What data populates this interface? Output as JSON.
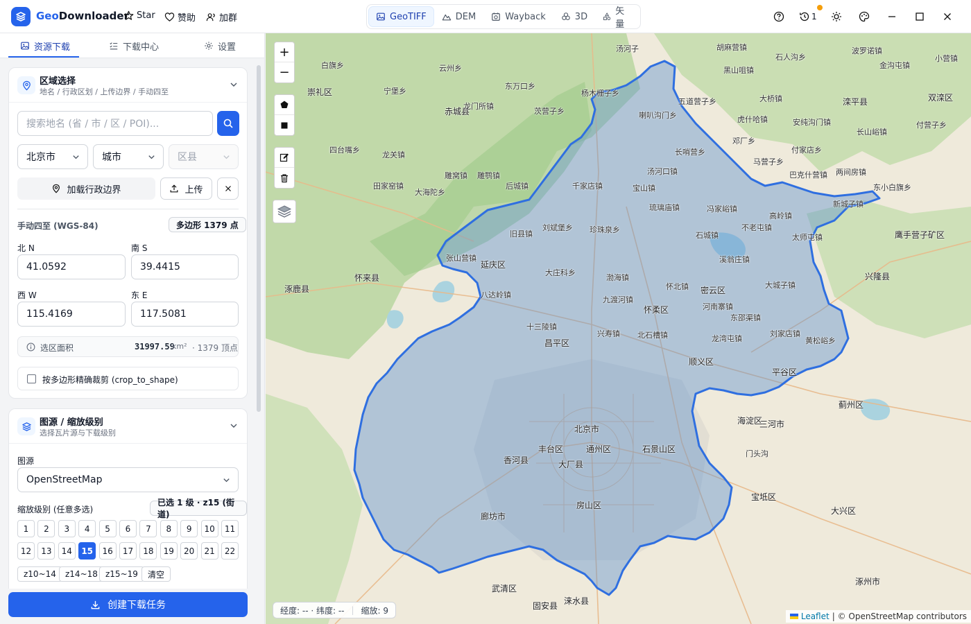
{
  "app": {
    "name_accent": "Geo",
    "name_rest": "Downloader"
  },
  "header_links": {
    "star": "Star",
    "like": "赞助",
    "group": "加群"
  },
  "modes": [
    {
      "label": "GeoTIFF",
      "icon": "image-icon"
    },
    {
      "label": "DEM",
      "icon": "mountain-icon"
    },
    {
      "label": "Wayback",
      "icon": "history-icon"
    },
    {
      "label": "3D",
      "icon": "cube-icon"
    },
    {
      "label": "矢量",
      "icon": "shapes-icon"
    }
  ],
  "history_count": "1",
  "subtabs": {
    "resources": "资源下载",
    "downloads": "下载中心",
    "settings": "设置"
  },
  "region": {
    "title": "区域选择",
    "subtitle": "地名 / 行政区划 / 上传边界 / 手动四至",
    "search_placeholder": "搜索地名 (省 / 市 / 区 / POI)...",
    "province": "北京市",
    "city": "城市",
    "county": "区县",
    "load_boundary": "加载行政边界",
    "upload": "上传",
    "manual_label": "手动四至 (WGS-84)",
    "polygon_badge": "多边形 1379 点",
    "north_label": "北 N",
    "north_value": "41.0592",
    "south_label": "南 S",
    "south_value": "39.4415",
    "west_label": "西 W",
    "west_value": "115.4169",
    "east_label": "东 E",
    "east_value": "117.5081",
    "area_label": "选区面积",
    "area_value": "31997.59",
    "area_unit": "km²",
    "vertex_text": "· 1379 顶点",
    "crop_label": "按多边形精确裁剪 (crop_to_shape)"
  },
  "source": {
    "title": "图源 / 缩放级别",
    "subtitle": "选择瓦片源与下载级别",
    "source_label": "图源",
    "source_value": "OpenStreetMap",
    "zoom_label": "缩放级别 (任意多选)",
    "zoom_badge": "已选 1 级 · z15 (街道)",
    "zoom_levels": [
      "1",
      "2",
      "3",
      "4",
      "5",
      "6",
      "7",
      "8",
      "9",
      "10",
      "11",
      "12",
      "13",
      "14",
      "15",
      "16",
      "17",
      "18",
      "19",
      "20",
      "21",
      "22"
    ],
    "selected_zoom": "15",
    "presets": [
      "z10~14",
      "z14~18",
      "z15~19",
      "清空"
    ]
  },
  "create_button": "创建下载任务",
  "map": {
    "zoom_in": "+",
    "zoom_out": "−",
    "coord_text": "经度: -- · 纬度: --",
    "zoom_text": "缩放: 9",
    "attribution_leaflet": "Leaflet",
    "attribution_rest": "| © OpenStreetMap contributors",
    "colors": {
      "boundary": "#2f6fe0",
      "fill": "#5b8fcf"
    },
    "places": [
      {
        "name": "汤河子",
        "big": false
      },
      {
        "name": "胡麻营镇",
        "big": false
      },
      {
        "name": "石人沟乡",
        "big": false
      },
      {
        "name": "波罗诺镇",
        "big": false
      },
      {
        "name": "小营镇",
        "big": false
      },
      {
        "name": "白旗乡",
        "big": false
      },
      {
        "name": "云州乡",
        "big": false
      },
      {
        "name": "黑山咀镇",
        "big": false
      },
      {
        "name": "金沟屯镇",
        "big": false
      },
      {
        "name": "崇礼区",
        "big": true
      },
      {
        "name": "东万口乡",
        "big": false
      },
      {
        "name": "赤城县",
        "big": true
      },
      {
        "name": "杨木栅子乡",
        "big": false
      },
      {
        "name": "五道营子乡",
        "big": false
      },
      {
        "name": "大桥镇",
        "big": false
      },
      {
        "name": "滦平县",
        "big": true
      },
      {
        "name": "双滦区",
        "big": true
      },
      {
        "name": "宁堡乡",
        "big": false
      },
      {
        "name": "龙门所镇",
        "big": false
      },
      {
        "name": "茨营子乡",
        "big": false
      },
      {
        "name": "喇叭沟门乡",
        "big": false
      },
      {
        "name": "虎什哈镇",
        "big": false
      },
      {
        "name": "安纯沟门镇",
        "big": false
      },
      {
        "name": "长山峪镇",
        "big": false
      },
      {
        "name": "付营子乡",
        "big": false
      },
      {
        "name": "雕鹗镇",
        "big": false
      },
      {
        "name": "四台嘴乡",
        "big": false
      },
      {
        "name": "龙关镇",
        "big": false
      },
      {
        "name": "长哨营乡",
        "big": false
      },
      {
        "name": "邓厂乡",
        "big": false
      },
      {
        "name": "付家店乡",
        "big": false
      },
      {
        "name": "汤河口镇",
        "big": false
      },
      {
        "name": "马营子乡",
        "big": false
      },
      {
        "name": "巴克什营镇",
        "big": false
      },
      {
        "name": "两间房镇",
        "big": false
      },
      {
        "name": "雕窝镇",
        "big": false
      },
      {
        "name": "田家窑镇",
        "big": false
      },
      {
        "name": "大海陀乡",
        "big": false
      },
      {
        "name": "后城镇",
        "big": false
      },
      {
        "name": "千家店镇",
        "big": false
      },
      {
        "name": "宝山镇",
        "big": false
      },
      {
        "name": "琉璃庙镇",
        "big": false
      },
      {
        "name": "冯家峪镇",
        "big": false
      },
      {
        "name": "新城子镇",
        "big": false
      },
      {
        "name": "东小白旗乡",
        "big": false
      },
      {
        "name": "鹰手营子矿区",
        "big": true
      },
      {
        "name": "刘斌堡乡",
        "big": false
      },
      {
        "name": "珍珠泉乡",
        "big": false
      },
      {
        "name": "石城镇",
        "big": false
      },
      {
        "name": "不老屯镇",
        "big": false
      },
      {
        "name": "高岭镇",
        "big": false
      },
      {
        "name": "太师屯镇",
        "big": false
      },
      {
        "name": "旧县镇",
        "big": false
      },
      {
        "name": "张山营镇",
        "big": false
      },
      {
        "name": "延庆区",
        "big": true
      },
      {
        "name": "大庄科乡",
        "big": false
      },
      {
        "name": "渤海镇",
        "big": false
      },
      {
        "name": "溪翁庄镇",
        "big": false
      },
      {
        "name": "兴隆县",
        "big": true
      },
      {
        "name": "怀来县",
        "big": true
      },
      {
        "name": "八达岭镇",
        "big": false
      },
      {
        "name": "九渡河镇",
        "big": false
      },
      {
        "name": "怀北镇",
        "big": false
      },
      {
        "name": "密云区",
        "big": true
      },
      {
        "name": "大城子镇",
        "big": false
      },
      {
        "name": "涿鹿县",
        "big": true
      },
      {
        "name": "怀柔区",
        "big": true
      },
      {
        "name": "河南寨镇",
        "big": false
      },
      {
        "name": "东邵渠镇",
        "big": false
      },
      {
        "name": "十三陵镇",
        "big": false
      },
      {
        "name": "昌平区",
        "big": true
      },
      {
        "name": "兴寿镇",
        "big": false
      },
      {
        "name": "北石槽镇",
        "big": false
      },
      {
        "name": "龙湾屯镇",
        "big": false
      },
      {
        "name": "刘家店镇",
        "big": false
      },
      {
        "name": "黄松峪乡",
        "big": false
      },
      {
        "name": "顺义区",
        "big": true
      },
      {
        "name": "平谷区",
        "big": true
      },
      {
        "name": "三河市",
        "big": true
      },
      {
        "name": "蓟州区",
        "big": true
      },
      {
        "name": "海淀区",
        "big": true
      },
      {
        "name": "北京市",
        "big": true
      },
      {
        "name": "通州区",
        "big": true
      },
      {
        "name": "石景山区",
        "big": true
      },
      {
        "name": "丰台区",
        "big": true
      },
      {
        "name": "大厂县",
        "big": true
      },
      {
        "name": "门头沟",
        "big": false
      },
      {
        "name": "香河县",
        "big": true
      },
      {
        "name": "宝坻区",
        "big": true
      },
      {
        "name": "大兴区",
        "big": true
      },
      {
        "name": "房山区",
        "big": true
      },
      {
        "name": "廊坊市",
        "big": true
      },
      {
        "name": "涿州市",
        "big": true
      },
      {
        "name": "固安县",
        "big": true
      },
      {
        "name": "武清区",
        "big": true
      },
      {
        "name": "涞水县",
        "big": true
      }
    ]
  }
}
